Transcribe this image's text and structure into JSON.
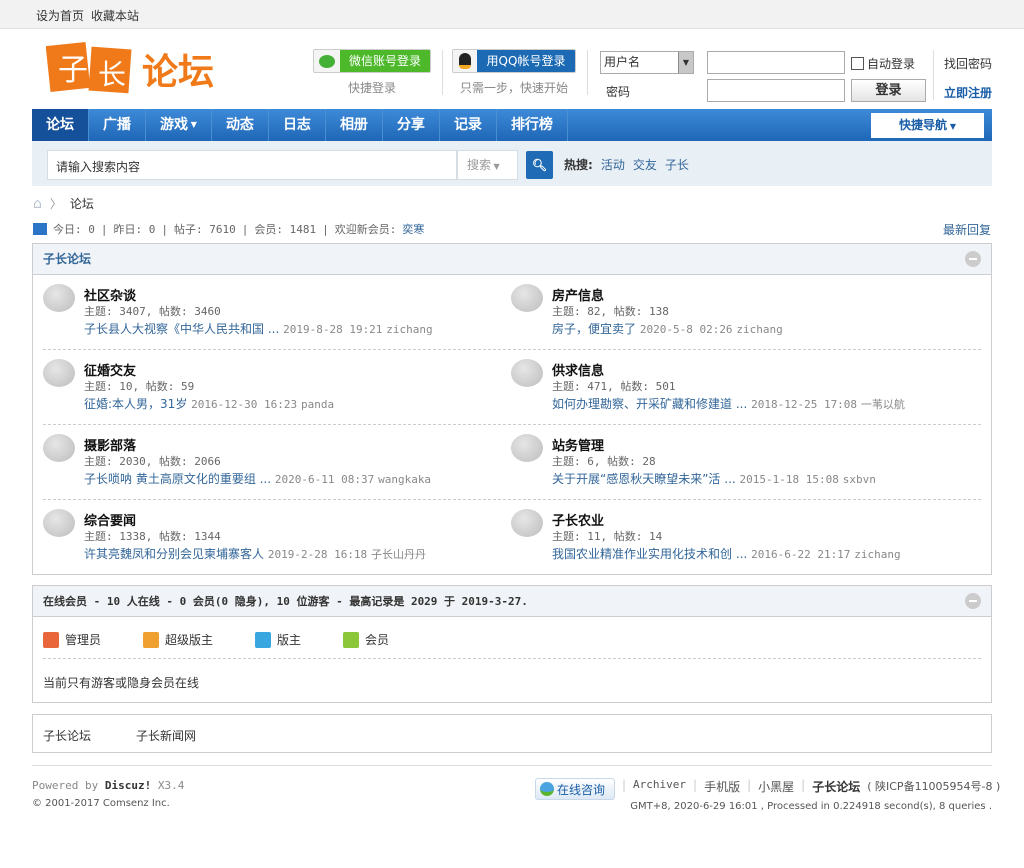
{
  "topbar": {
    "set_home": "设为首页",
    "bookmark": "收藏本站"
  },
  "header": {
    "logo_text": "子长论坛",
    "wechat_login": "微信账号登录",
    "wechat_sub": "快捷登录",
    "qq_login": "用QQ帐号登录",
    "qq_sub": "只需一步，快速开始",
    "username_select": "用户名",
    "password_label": "密码",
    "auto_login": "自动登录",
    "login_button": "登录",
    "forgot_password": "找回密码",
    "register": "立即注册"
  },
  "nav": {
    "items": [
      "论坛",
      "广播",
      "游戏",
      "动态",
      "日志",
      "相册",
      "分享",
      "记录",
      "排行榜"
    ],
    "quick_nav": "快捷导航"
  },
  "search": {
    "placeholder": "请输入搜索内容",
    "type": "搜索",
    "hot_label": "热搜:",
    "hot": [
      "活动",
      "交友",
      "子长"
    ]
  },
  "breadcrumb": {
    "current": "论坛"
  },
  "stats": {
    "today": "今日: 0",
    "yesterday": "昨日: 0",
    "posts": "帖子: 7610",
    "members": "会员: 1481",
    "welcome": "欢迎新会员:",
    "new_member": "奕寒",
    "latest_reply": "最新回复"
  },
  "forum_section": {
    "title": "子长论坛",
    "forums": [
      {
        "name": "社区杂谈",
        "stats": "主题: 3407, 帖数: 3460",
        "last_title": "子长县人大视察《中华人民共和国 ...",
        "last_time": "2019-8-28 19:21",
        "last_user": "zichang"
      },
      {
        "name": "房产信息",
        "stats": "主题: 82, 帖数: 138",
        "last_title": "房子，便宜卖了",
        "last_time": "2020-5-8 02:26",
        "last_user": "zichang"
      },
      {
        "name": "征婚交友",
        "stats": "主题: 10, 帖数: 59",
        "last_title": "征婚:本人男，31岁",
        "last_time": "2016-12-30 16:23",
        "last_user": "panda"
      },
      {
        "name": "供求信息",
        "stats": "主题: 471, 帖数: 501",
        "last_title": "如何办理勘察、开采矿藏和修建道 ...",
        "last_time": "2018-12-25 17:08",
        "last_user": "一苇以航"
      },
      {
        "name": "摄影部落",
        "stats": "主题: 2030, 帖数: 2066",
        "last_title": "子长唢呐 黄土高原文化的重要组 ...",
        "last_time": "2020-6-11 08:37",
        "last_user": "wangkaka"
      },
      {
        "name": "站务管理",
        "stats": "主题: 6, 帖数: 28",
        "last_title": "关于开展“感恩秋天瞭望未来”活 ...",
        "last_time": "2015-1-18 15:08",
        "last_user": "sxbvn"
      },
      {
        "name": "综合要闻",
        "stats": "主题: 1338, 帖数: 1344",
        "last_title": "许其亮魏凤和分别会见柬埔寨客人",
        "last_time": "2019-2-28 16:18",
        "last_user": "子长山丹丹"
      },
      {
        "name": "子长农业",
        "stats": "主题: 11, 帖数: 14",
        "last_title": "我国农业精准作业实用化技术和创 ...",
        "last_time": "2016-6-22 21:17",
        "last_user": "zichang"
      }
    ]
  },
  "online": {
    "title": "在线会员 - 10 人在线 - 0 会员(0 隐身), 10 位游客 - 最高记录是 2029 于 2019-3-27.",
    "legend": [
      {
        "label": "管理员",
        "color": "#e8663a"
      },
      {
        "label": "超级版主",
        "color": "#f0a030"
      },
      {
        "label": "版主",
        "color": "#3aa6e0"
      },
      {
        "label": "会员",
        "color": "#8cc63a"
      }
    ],
    "note": "当前只有游客或隐身会员在线"
  },
  "links": [
    "子长论坛",
    "子长新闻网"
  ],
  "footer": {
    "powered": "Powered by",
    "discuz": "Discuz!",
    "version": "X3.4",
    "copyright": "© 2001-2017 Comsenz Inc.",
    "consult": "在线咨询",
    "links": [
      "Archiver",
      "手机版",
      "小黑屋"
    ],
    "site": "子长论坛",
    "icp": "( 陕ICP备11005954号-8 )",
    "processed": "GMT+8, 2020-6-29 16:01 , Processed in 0.224918 second(s), 8 queries ."
  },
  "colors": {
    "nav": "#2b74c8",
    "link": "#336699",
    "logo": "#f07a1a"
  }
}
